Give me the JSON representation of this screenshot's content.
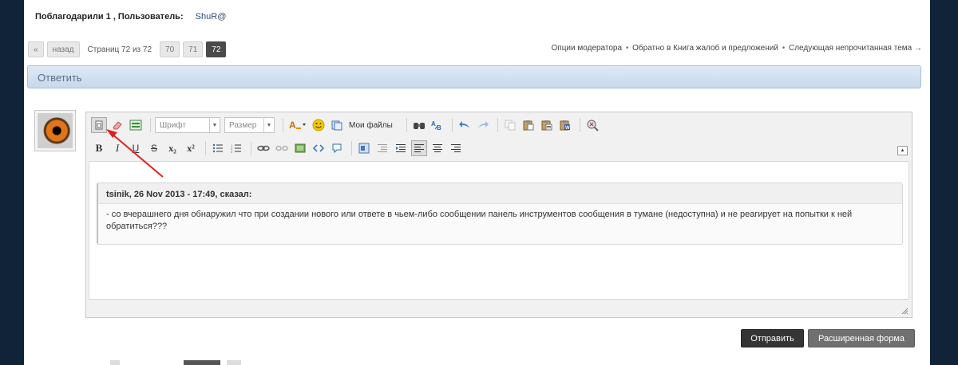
{
  "thanks": {
    "label": "Поблагодарили 1 , Пользователь:",
    "user": "ShuR@"
  },
  "pagination": {
    "first": "«",
    "prev": "назад",
    "pages_text": "Страниц 72 из 72",
    "pages": [
      "70",
      "71",
      "72"
    ],
    "current": "72"
  },
  "mod_links": {
    "options": "Опции модератора",
    "back": "Обратно в Книга жалоб и предложений",
    "next": "Следующая непрочитанная тема",
    "arrow": "→",
    "dot": "•"
  },
  "reply_title": "Ответить",
  "toolbar": {
    "font_placeholder": "Шрифт",
    "size_placeholder": "Размер",
    "my_files": "Мои файлы",
    "bold": "B",
    "italic": "I",
    "underline": "U",
    "strike": "S",
    "sub": "x₂",
    "sup": "x²"
  },
  "quote": {
    "header": "tsinik, 26 Nov 2013 - 17:49, сказал:",
    "body": "- со вчерашнего дня обнаружил что при создании нового или ответе в чьем-либо сообщении панель инструментов сообщения в тумане (недоступна) и не реагирует на попытки к ней обратиться???"
  },
  "buttons": {
    "send": "Отправить",
    "advanced": "Расширенная форма"
  },
  "colors": {
    "background": "#102338",
    "accent": "#c7d9ec",
    "arrow": "#e02020"
  }
}
